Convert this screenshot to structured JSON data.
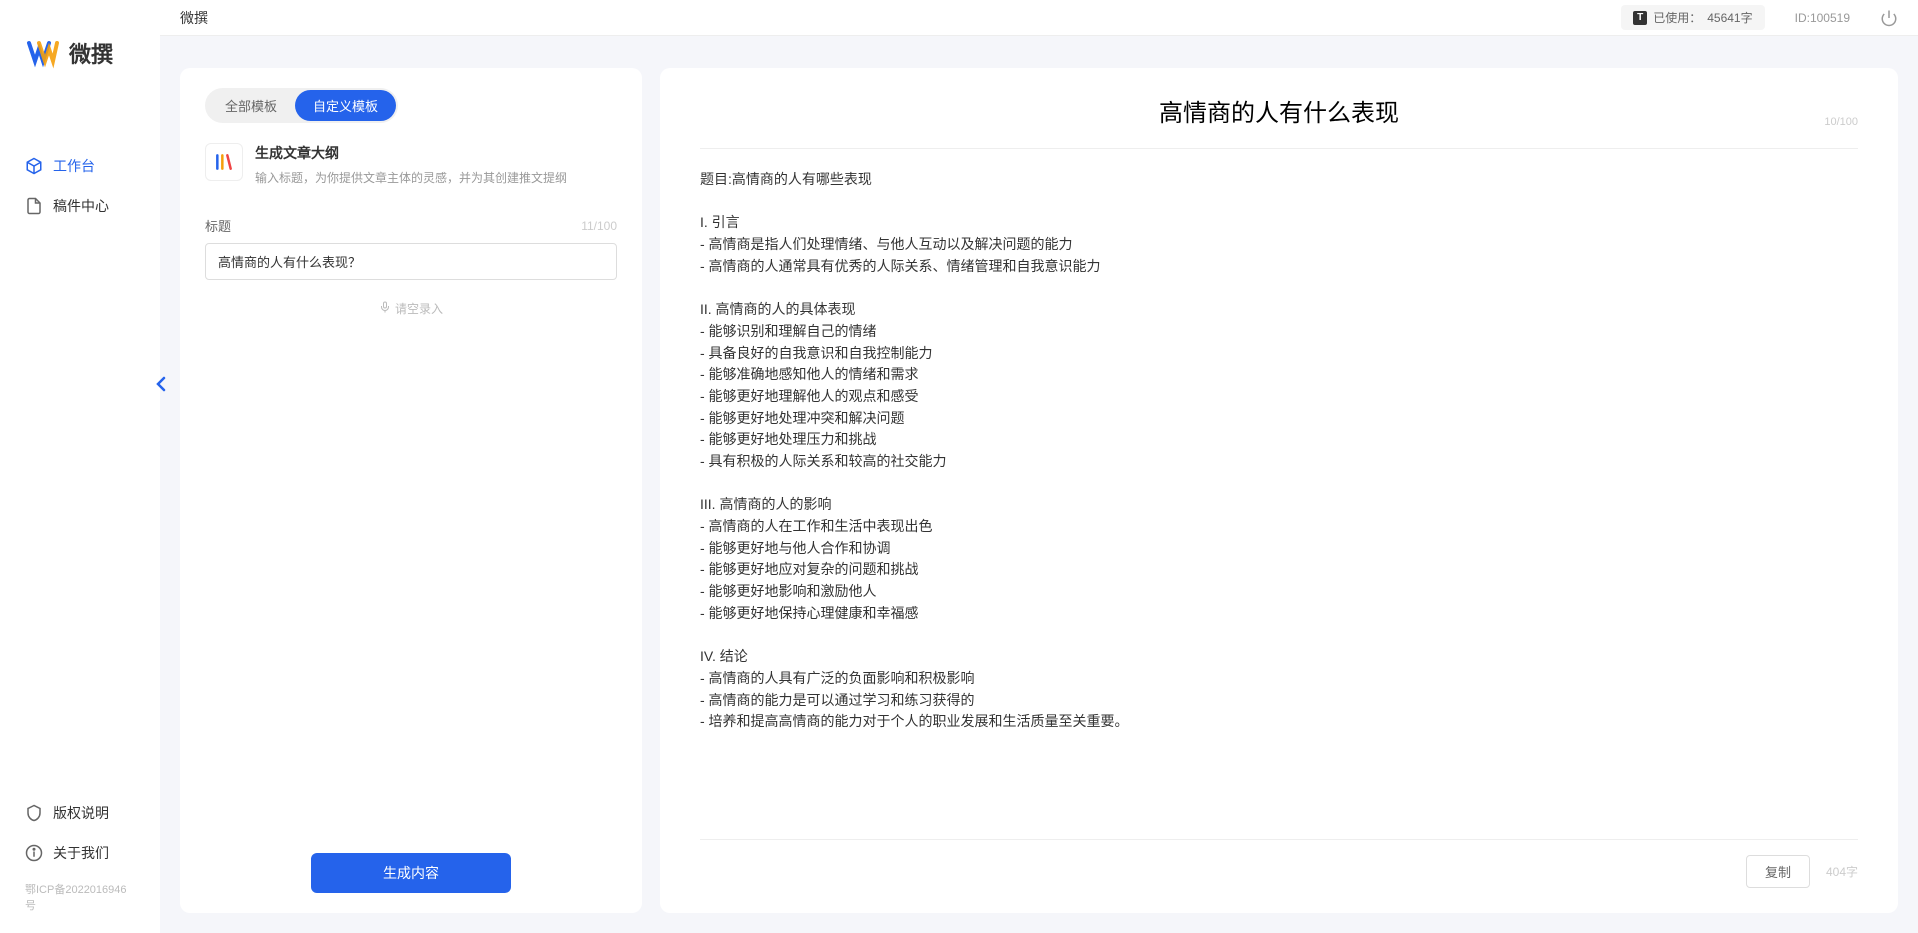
{
  "brand": "微撰",
  "sidebar": {
    "items": [
      {
        "label": "工作台",
        "active": true
      },
      {
        "label": "稿件中心",
        "active": false
      }
    ],
    "bottom": [
      {
        "label": "版权说明"
      },
      {
        "label": "关于我们"
      }
    ],
    "icp": "鄂ICP备2022016946号"
  },
  "header": {
    "title": "微撰",
    "usage_label": "已使用：",
    "usage_value": "45641字",
    "id_label": "ID:100519"
  },
  "left": {
    "tabs": [
      {
        "label": "全部模板",
        "active": false
      },
      {
        "label": "自定义模板",
        "active": true
      }
    ],
    "template": {
      "title": "生成文章大纲",
      "desc": "输入标题，为你提供文章主体的灵感，并为其创建推文提纲"
    },
    "field_label": "标题",
    "field_counter": "11/100",
    "title_value": "高情商的人有什么表现？",
    "voice_label": "请空录入",
    "generate_label": "生成内容"
  },
  "output": {
    "title": "高情商的人有什么表现",
    "title_counter": "10/100",
    "body": "题目:高情商的人有哪些表现\n\nI. 引言\n- 高情商是指人们处理情绪、与他人互动以及解决问题的能力\n- 高情商的人通常具有优秀的人际关系、情绪管理和自我意识能力\n\nII. 高情商的人的具体表现\n- 能够识别和理解自己的情绪\n- 具备良好的自我意识和自我控制能力\n- 能够准确地感知他人的情绪和需求\n- 能够更好地理解他人的观点和感受\n- 能够更好地处理冲突和解决问题\n- 能够更好地处理压力和挑战\n- 具有积极的人际关系和较高的社交能力\n\nIII. 高情商的人的影响\n- 高情商的人在工作和生活中表现出色\n- 能够更好地与他人合作和协调\n- 能够更好地应对复杂的问题和挑战\n- 能够更好地影响和激励他人\n- 能够更好地保持心理健康和幸福感\n\nIV. 结论\n- 高情商的人具有广泛的负面影响和积极影响\n- 高情商的能力是可以通过学习和练习获得的\n- 培养和提高高情商的能力对于个人的职业发展和生活质量至关重要。",
    "copy_label": "复制",
    "word_count": "404字"
  }
}
